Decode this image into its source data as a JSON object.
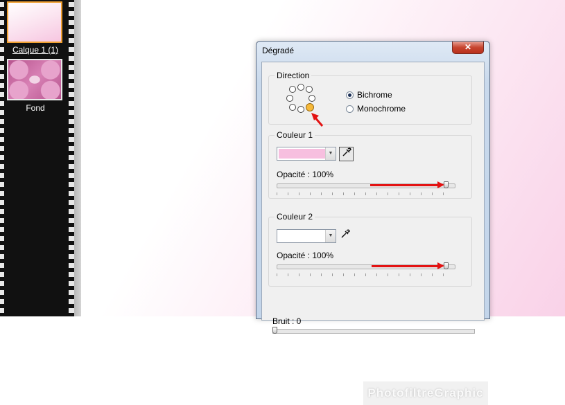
{
  "layers": [
    {
      "label": "Calque 1 (1)"
    },
    {
      "label": "Fond"
    }
  ],
  "dialog": {
    "title": "Dégradé",
    "close_label": "✕",
    "direction": {
      "label": "Direction",
      "options": [
        "Bichrome",
        "Monochrome"
      ],
      "selected": "Bichrome"
    },
    "color1": {
      "label": "Couleur 1",
      "swatch_color": "#f7bfdf",
      "opacity_label": "Opacité : 100%",
      "opacity": 1.0
    },
    "color2": {
      "label": "Couleur 2",
      "swatch_color": "#ffffff",
      "opacity_label": "Opacité : 100%",
      "opacity": 1.0
    },
    "noise": {
      "label": "Bruit : 0",
      "value": 0
    }
  },
  "watermark": "PhotofiltreGraphic",
  "colors": {
    "accent_orange": "#f6b93a",
    "annotation_red": "#e31313",
    "close_red": "#c7452f"
  }
}
